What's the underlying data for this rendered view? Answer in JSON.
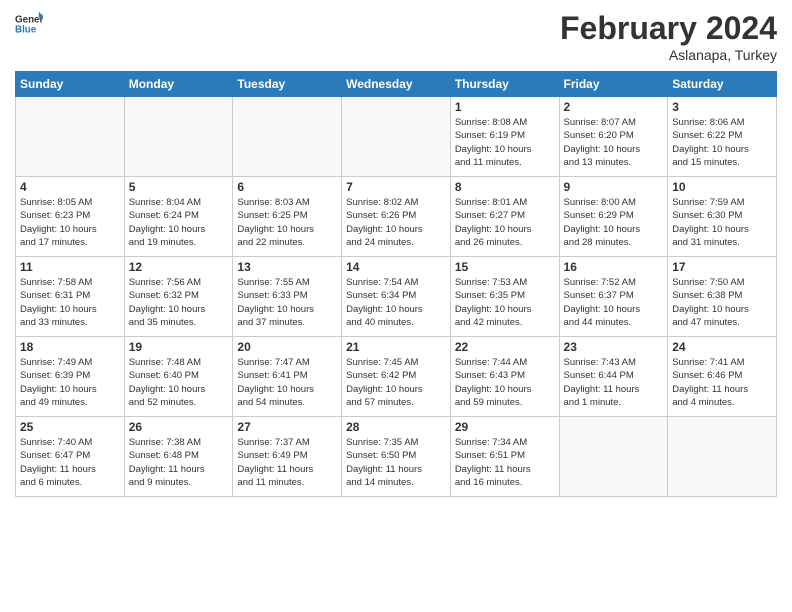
{
  "header": {
    "logo_general": "General",
    "logo_blue": "Blue",
    "month_year": "February 2024",
    "location": "Aslanapa, Turkey"
  },
  "days_of_week": [
    "Sunday",
    "Monday",
    "Tuesday",
    "Wednesday",
    "Thursday",
    "Friday",
    "Saturday"
  ],
  "weeks": [
    [
      {
        "day": "",
        "info": ""
      },
      {
        "day": "",
        "info": ""
      },
      {
        "day": "",
        "info": ""
      },
      {
        "day": "",
        "info": ""
      },
      {
        "day": "1",
        "info": "Sunrise: 8:08 AM\nSunset: 6:19 PM\nDaylight: 10 hours\nand 11 minutes."
      },
      {
        "day": "2",
        "info": "Sunrise: 8:07 AM\nSunset: 6:20 PM\nDaylight: 10 hours\nand 13 minutes."
      },
      {
        "day": "3",
        "info": "Sunrise: 8:06 AM\nSunset: 6:22 PM\nDaylight: 10 hours\nand 15 minutes."
      }
    ],
    [
      {
        "day": "4",
        "info": "Sunrise: 8:05 AM\nSunset: 6:23 PM\nDaylight: 10 hours\nand 17 minutes."
      },
      {
        "day": "5",
        "info": "Sunrise: 8:04 AM\nSunset: 6:24 PM\nDaylight: 10 hours\nand 19 minutes."
      },
      {
        "day": "6",
        "info": "Sunrise: 8:03 AM\nSunset: 6:25 PM\nDaylight: 10 hours\nand 22 minutes."
      },
      {
        "day": "7",
        "info": "Sunrise: 8:02 AM\nSunset: 6:26 PM\nDaylight: 10 hours\nand 24 minutes."
      },
      {
        "day": "8",
        "info": "Sunrise: 8:01 AM\nSunset: 6:27 PM\nDaylight: 10 hours\nand 26 minutes."
      },
      {
        "day": "9",
        "info": "Sunrise: 8:00 AM\nSunset: 6:29 PM\nDaylight: 10 hours\nand 28 minutes."
      },
      {
        "day": "10",
        "info": "Sunrise: 7:59 AM\nSunset: 6:30 PM\nDaylight: 10 hours\nand 31 minutes."
      }
    ],
    [
      {
        "day": "11",
        "info": "Sunrise: 7:58 AM\nSunset: 6:31 PM\nDaylight: 10 hours\nand 33 minutes."
      },
      {
        "day": "12",
        "info": "Sunrise: 7:56 AM\nSunset: 6:32 PM\nDaylight: 10 hours\nand 35 minutes."
      },
      {
        "day": "13",
        "info": "Sunrise: 7:55 AM\nSunset: 6:33 PM\nDaylight: 10 hours\nand 37 minutes."
      },
      {
        "day": "14",
        "info": "Sunrise: 7:54 AM\nSunset: 6:34 PM\nDaylight: 10 hours\nand 40 minutes."
      },
      {
        "day": "15",
        "info": "Sunrise: 7:53 AM\nSunset: 6:35 PM\nDaylight: 10 hours\nand 42 minutes."
      },
      {
        "day": "16",
        "info": "Sunrise: 7:52 AM\nSunset: 6:37 PM\nDaylight: 10 hours\nand 44 minutes."
      },
      {
        "day": "17",
        "info": "Sunrise: 7:50 AM\nSunset: 6:38 PM\nDaylight: 10 hours\nand 47 minutes."
      }
    ],
    [
      {
        "day": "18",
        "info": "Sunrise: 7:49 AM\nSunset: 6:39 PM\nDaylight: 10 hours\nand 49 minutes."
      },
      {
        "day": "19",
        "info": "Sunrise: 7:48 AM\nSunset: 6:40 PM\nDaylight: 10 hours\nand 52 minutes."
      },
      {
        "day": "20",
        "info": "Sunrise: 7:47 AM\nSunset: 6:41 PM\nDaylight: 10 hours\nand 54 minutes."
      },
      {
        "day": "21",
        "info": "Sunrise: 7:45 AM\nSunset: 6:42 PM\nDaylight: 10 hours\nand 57 minutes."
      },
      {
        "day": "22",
        "info": "Sunrise: 7:44 AM\nSunset: 6:43 PM\nDaylight: 10 hours\nand 59 minutes."
      },
      {
        "day": "23",
        "info": "Sunrise: 7:43 AM\nSunset: 6:44 PM\nDaylight: 11 hours\nand 1 minute."
      },
      {
        "day": "24",
        "info": "Sunrise: 7:41 AM\nSunset: 6:46 PM\nDaylight: 11 hours\nand 4 minutes."
      }
    ],
    [
      {
        "day": "25",
        "info": "Sunrise: 7:40 AM\nSunset: 6:47 PM\nDaylight: 11 hours\nand 6 minutes."
      },
      {
        "day": "26",
        "info": "Sunrise: 7:38 AM\nSunset: 6:48 PM\nDaylight: 11 hours\nand 9 minutes."
      },
      {
        "day": "27",
        "info": "Sunrise: 7:37 AM\nSunset: 6:49 PM\nDaylight: 11 hours\nand 11 minutes."
      },
      {
        "day": "28",
        "info": "Sunrise: 7:35 AM\nSunset: 6:50 PM\nDaylight: 11 hours\nand 14 minutes."
      },
      {
        "day": "29",
        "info": "Sunrise: 7:34 AM\nSunset: 6:51 PM\nDaylight: 11 hours\nand 16 minutes."
      },
      {
        "day": "",
        "info": ""
      },
      {
        "day": "",
        "info": ""
      }
    ]
  ]
}
